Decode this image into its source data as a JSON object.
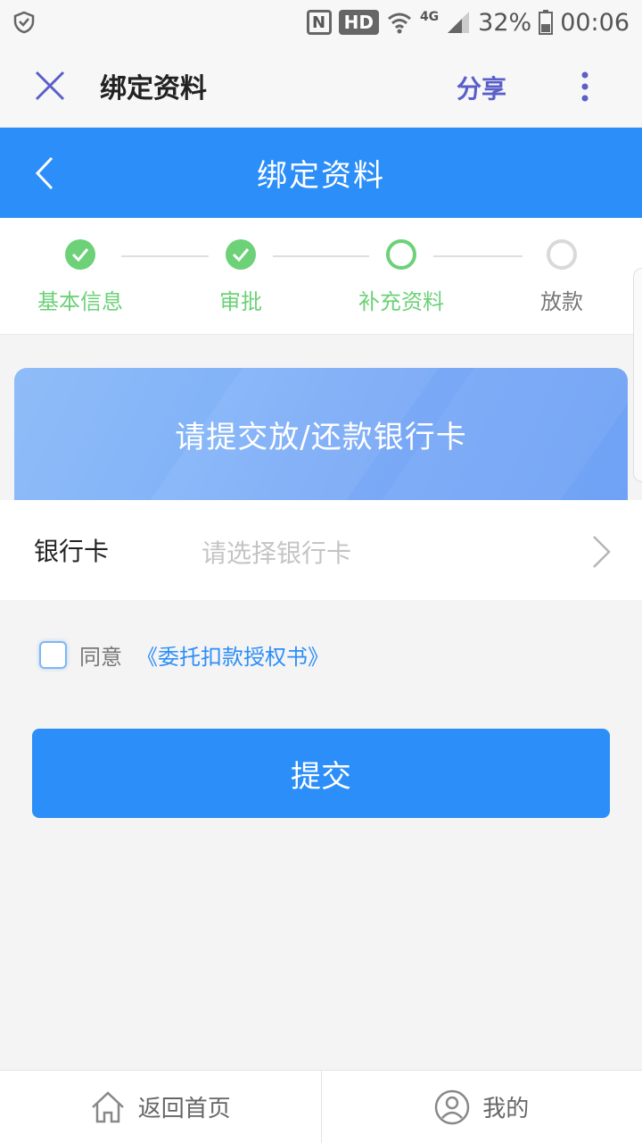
{
  "status_bar": {
    "nfc": "N",
    "hd": "HD",
    "network": "4G",
    "battery": "32%",
    "time": "00:06"
  },
  "app_bar": {
    "title": "绑定资料",
    "share_label": "分享"
  },
  "page_header": {
    "title": "绑定资料"
  },
  "steps": [
    {
      "label": "基本信息",
      "state": "done"
    },
    {
      "label": "审批",
      "state": "done"
    },
    {
      "label": "补充资料",
      "state": "current"
    },
    {
      "label": "放款",
      "state": "todo"
    }
  ],
  "banner": {
    "text": "请提交放/还款银行卡"
  },
  "bank_card": {
    "label": "银行卡",
    "placeholder": "请选择银行卡"
  },
  "agreement": {
    "prefix": "同意",
    "link": "《委托扣款授权书》",
    "checked": false
  },
  "submit_label": "提交",
  "bottom_nav": {
    "home_label": "返回首页",
    "mine_label": "我的"
  },
  "colors": {
    "primary": "#2c8ef8",
    "success": "#6cd177",
    "share": "#5a5fc9"
  }
}
